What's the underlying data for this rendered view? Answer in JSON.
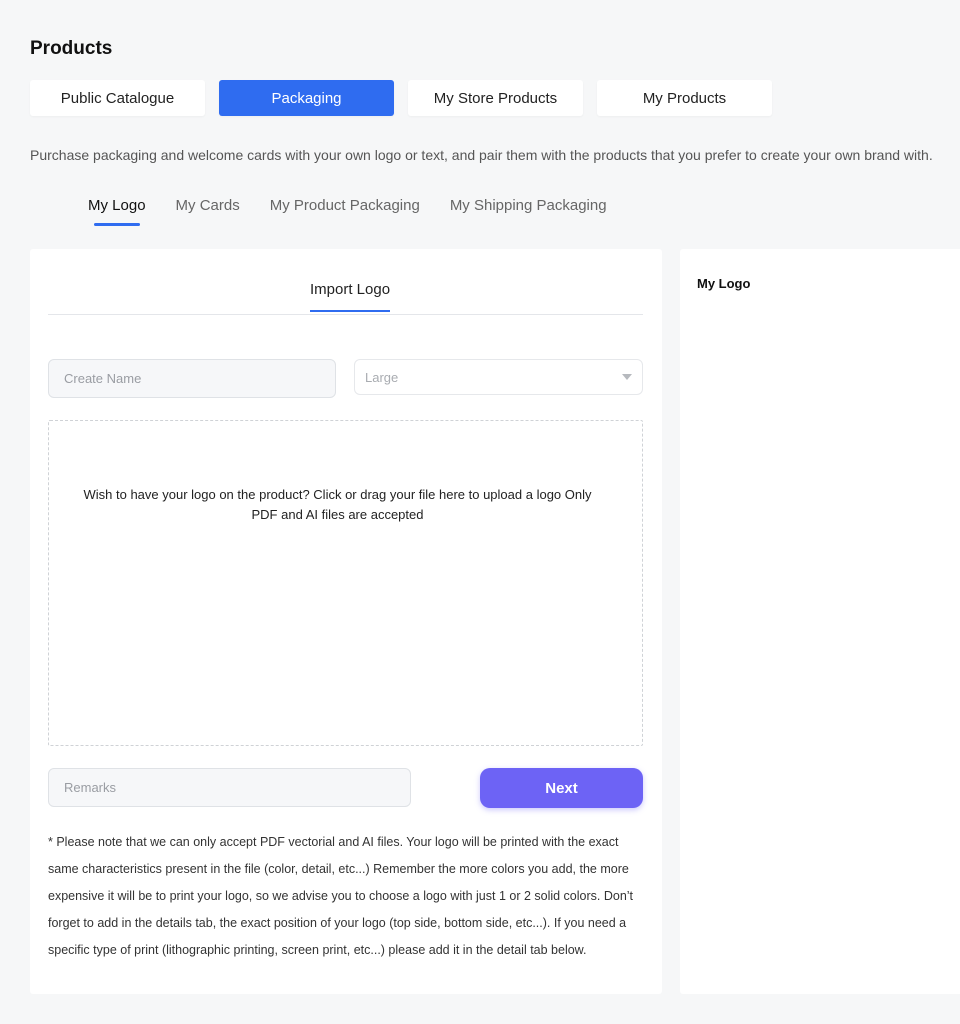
{
  "page": {
    "title": "Products"
  },
  "top_tabs": [
    {
      "label": "Public Catalogue"
    },
    {
      "label": "Packaging"
    },
    {
      "label": "My Store Products"
    },
    {
      "label": "My Products"
    }
  ],
  "description": "Purchase packaging and welcome cards with your own logo or text, and pair them with the products that you prefer to create your own brand with.",
  "sub_tabs": [
    {
      "label": "My Logo"
    },
    {
      "label": "My Cards"
    },
    {
      "label": "My Product Packaging"
    },
    {
      "label": "My Shipping Packaging"
    }
  ],
  "form": {
    "tab_label": "Import Logo",
    "name_placeholder": "Create Name",
    "size_value": "Large",
    "dropzone_text": "Wish to have your logo on the product? Click or drag your file here to upload a logo Only PDF and AI files are accepted",
    "remarks_placeholder": "Remarks",
    "next_label": "Next",
    "note": "* Please note that we can only accept PDF vectorial and AI files. Your logo will be printed with the exact same characteristics present in the file (color, detail, etc...) Remember the more colors you add, the more expensive it will be to print your logo, so we advise you to choose a logo with just 1 or 2 solid colors. Don’t forget to add in the details tab, the exact position of your logo (top side, bottom side, etc...). If you need a specific type of print (lithographic printing, screen print, etc...) please add it in the detail tab below."
  },
  "side_panel": {
    "title": "My Logo"
  },
  "colors": {
    "accent": "#2f6cf0",
    "primary_button": "#6d63f5",
    "background": "#f6f7f8"
  }
}
